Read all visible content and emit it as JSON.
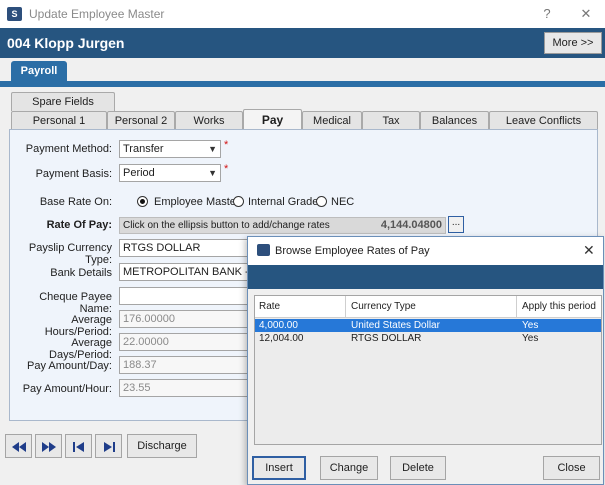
{
  "window": {
    "title": "Update Employee Master",
    "help": "?",
    "close": "✕"
  },
  "header": {
    "employee": "004 Klopp Jurgen",
    "more_label": "More >>"
  },
  "module_tab": "Payroll",
  "tabs": {
    "row1": [
      "Spare Fields"
    ],
    "row2": [
      "Personal 1",
      "Personal 2",
      "Works",
      "Pay",
      "Medical",
      "Tax",
      "Balances",
      "Leave Conflicts"
    ],
    "active": "Pay"
  },
  "form": {
    "payment_method": {
      "label": "Payment Method:",
      "value": "Transfer"
    },
    "payment_basis": {
      "label": "Payment Basis:",
      "value": "Period"
    },
    "base_rate": {
      "label": "Base Rate On:",
      "options": [
        "Employee Master",
        "Internal Grade",
        "NEC"
      ],
      "selected": "Employee Master"
    },
    "rate_of_pay": {
      "label": "Rate Of Pay:",
      "hint": "Click on the ellipsis button to add/change rates",
      "value": "4,144.04800",
      "button": "..."
    },
    "payslip_currency": {
      "label": "Payslip Currency Type:",
      "value": "RTGS DOLLAR"
    },
    "bank_details": {
      "label": "Bank Details",
      "value": "METROPOLITAN BANK - BEL"
    },
    "cheque_payee": {
      "label": "Cheque Payee Name:",
      "value": ""
    },
    "avg_hours": {
      "label": "Average Hours/Period:",
      "value": "176.00000"
    },
    "avg_days": {
      "label": "Average Days/Period:",
      "value": "22.00000"
    },
    "pay_day": {
      "label": "Pay Amount/Day:",
      "value": "188.37"
    },
    "pay_hour": {
      "label": "Pay Amount/Hour:",
      "value": "23.55"
    },
    "required_mark": "*"
  },
  "bottom": {
    "discharge_label": "Discharge"
  },
  "modal": {
    "title": "Browse Employee Rates of Pay",
    "close": "✕",
    "columns": [
      "Rate",
      "Currency Type",
      "Apply this period"
    ],
    "rows": [
      {
        "rate": "4,000.00",
        "currency": "United States Dollar",
        "apply": "Yes"
      },
      {
        "rate": "12,004.00",
        "currency": "RTGS DOLLAR",
        "apply": "Yes"
      }
    ],
    "buttons": {
      "insert": "Insert",
      "change": "Change",
      "delete": "Delete",
      "close": "Close"
    }
  },
  "colors": {
    "header_band": "#265580",
    "tab_blue": "#2b6ea6",
    "selection": "#2678d8",
    "required": "#d21414"
  }
}
